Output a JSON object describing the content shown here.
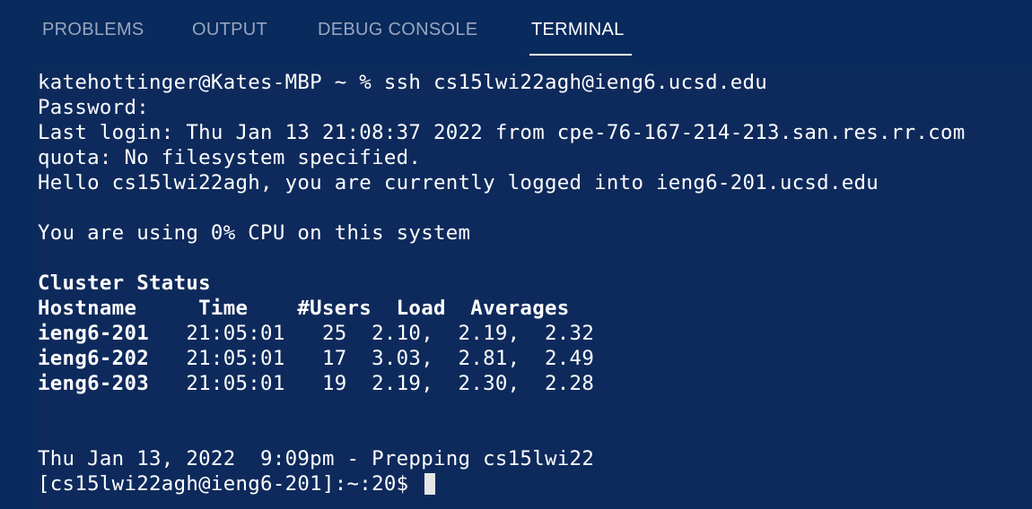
{
  "tabs": {
    "problems": "PROBLEMS",
    "output": "OUTPUT",
    "debug_console": "DEBUG CONSOLE",
    "terminal": "TERMINAL",
    "active": "TERMINAL"
  },
  "terminal": {
    "lines": {
      "l1": "katehottinger@Kates-MBP ~ % ssh cs15lwi22agh@ieng6.ucsd.edu",
      "l2": "Password:",
      "l3": "Last login: Thu Jan 13 21:08:37 2022 from cpe-76-167-214-213.san.res.rr.com",
      "l4": "quota: No filesystem specified.",
      "l5": "Hello cs15lwi22agh, you are currently logged into ieng6-201.ucsd.edu",
      "l6": "You are using 0% CPU on this system",
      "l7": "Cluster Status",
      "l8": "Hostname     Time    #Users  Load  Averages"
    },
    "cluster_rows": [
      {
        "host": "ieng6-201",
        "rest": "   21:05:01   25  2.10,  2.19,  2.32"
      },
      {
        "host": "ieng6-202",
        "rest": "   21:05:01   17  3.03,  2.81,  2.49"
      },
      {
        "host": "ieng6-203",
        "rest": "   21:05:01   19  2.19,  2.30,  2.28"
      }
    ],
    "footer": "Thu Jan 13, 2022  9:09pm - Prepping cs15lwi22",
    "prompt": "[cs15lwi22agh@ieng6-201]:~:20$ "
  },
  "colors": {
    "background": "#0e2a5c",
    "text": "#ffffff",
    "tab_inactive": "#9aa6bf"
  }
}
